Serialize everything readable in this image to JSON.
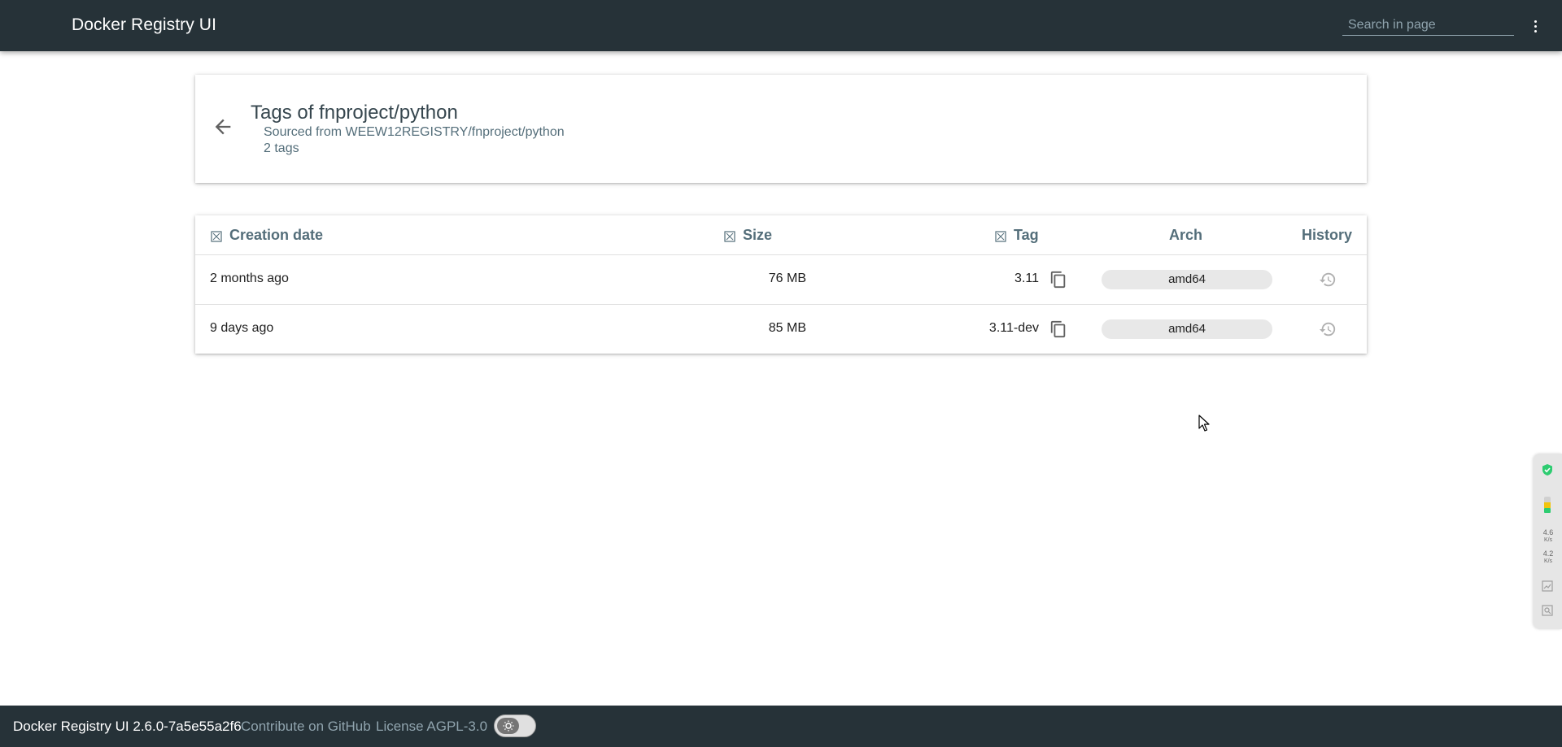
{
  "header": {
    "title": "Docker Registry UI",
    "search_placeholder": "Search in page"
  },
  "title_card": {
    "title": "Tags of fnproject/python",
    "source": "Sourced from WEEW12REGISTRY/fnproject/python",
    "count": "2 tags"
  },
  "table": {
    "columns": {
      "creation_date": "Creation date",
      "size": "Size",
      "tag": "Tag",
      "arch": "Arch",
      "history": "History"
    },
    "rows": [
      {
        "creation_date": "2 months ago",
        "size": "76 MB",
        "tag": "3.11",
        "arch": "amd64"
      },
      {
        "creation_date": "9 days ago",
        "size": "85 MB",
        "tag": "3.11-dev",
        "arch": "amd64"
      }
    ]
  },
  "side_widget": {
    "upload_speed": "4.6",
    "upload_unit": "K/s",
    "download_speed": "4.2",
    "download_unit": "K/s"
  },
  "footer": {
    "version": "Docker Registry UI 2.6.0-7a5e55a2f6",
    "github_link": "Contribute on GitHub",
    "license_link": "License AGPL-3.0"
  },
  "colors": {
    "header_bg": "#263238",
    "header_text": "#ffffff",
    "muted_text": "#90a4ae",
    "column_header_text": "#546e7a",
    "chip_bg": "#e8e8e8"
  }
}
